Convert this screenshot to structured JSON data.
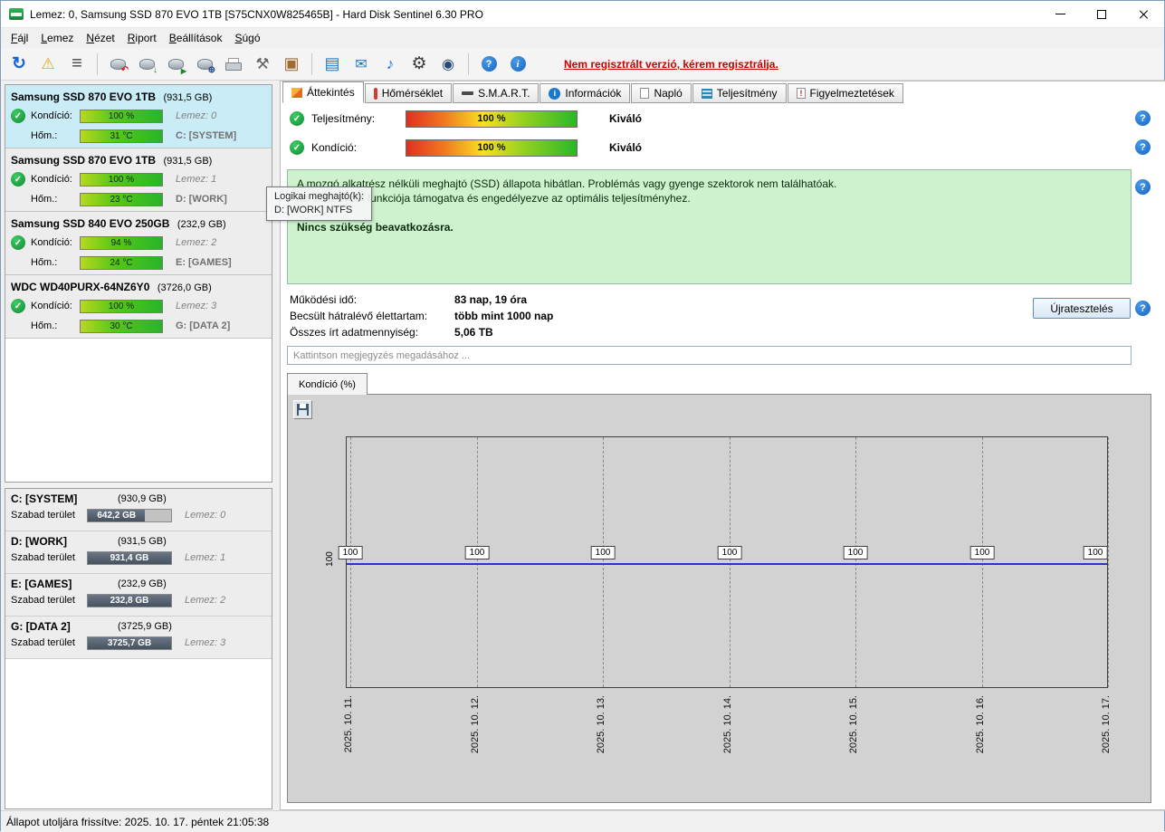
{
  "window": {
    "title": "Lemez: 0, Samsung SSD 870 EVO 1TB [S75CNX0W825465B]  -  Hard Disk Sentinel 6.30 PRO"
  },
  "menu": {
    "items": [
      "Fájl",
      "Lemez",
      "Nézet",
      "Riport",
      "Beállítások",
      "Súgó"
    ]
  },
  "toolbar": {
    "register_link": "Nem regisztrált verzió, kérem regisztrálja."
  },
  "sidebar": {
    "cond_label": "Kondíció:",
    "temp_label": "Hőm.:",
    "free_label": "Szabad terület",
    "disks": [
      {
        "name": "Samsung SSD 870 EVO 1TB",
        "size": "(931,5 GB)",
        "cond": "100 %",
        "lemez": "Lemez: 0",
        "temp": "31 °C",
        "volume": "C: [SYSTEM]"
      },
      {
        "name": "Samsung SSD 870 EVO 1TB",
        "size": "(931,5 GB)",
        "cond": "100 %",
        "lemez": "Lemez: 1",
        "temp": "23 °C",
        "volume": "D: [WORK]"
      },
      {
        "name": "Samsung SSD 840 EVO 250GB",
        "size": "(232,9 GB)",
        "cond": "94 %",
        "lemez": "Lemez: 2",
        "temp": "24 °C",
        "volume": "E: [GAMES]"
      },
      {
        "name": "WDC WD40PURX-64NZ6Y0",
        "size": "(3726,0 GB)",
        "cond": "100 %",
        "lemez": "Lemez: 3",
        "temp": "30 °C",
        "volume": "G: [DATA 2]"
      }
    ],
    "partitions": [
      {
        "name": "C: [SYSTEM]",
        "size": "(930,9 GB)",
        "free": "642,2 GB",
        "free_pct": 69,
        "lemez": "Lemez: 0"
      },
      {
        "name": "D: [WORK]",
        "size": "(931,5 GB)",
        "free": "931,4 GB",
        "free_pct": 100,
        "lemez": "Lemez: 1"
      },
      {
        "name": "E: [GAMES]",
        "size": "(232,9 GB)",
        "free": "232,8 GB",
        "free_pct": 100,
        "lemez": "Lemez: 2"
      },
      {
        "name": "G: [DATA 2]",
        "size": "(3725,9 GB)",
        "free": "3725,7 GB",
        "free_pct": 100,
        "lemez": "Lemez: 3"
      }
    ]
  },
  "tooltip": {
    "line1": "Logikai meghajtó(k):",
    "line2": "D: [WORK] NTFS"
  },
  "tabs": {
    "items": [
      "Áttekintés",
      "Hőmérséklet",
      "S.M.A.R.T.",
      "Információk",
      "Napló",
      "Teljesítmény",
      "Figyelmeztetések"
    ]
  },
  "overview": {
    "perf_label": "Teljesítmény:",
    "perf_value": "100 %",
    "perf_rating": "Kiváló",
    "cond_label": "Kondíció:",
    "cond_value": "100 %",
    "cond_rating": "Kiváló",
    "status_line1": "A mozgó alkatrész nélküli meghajtó (SSD) állapota hibátlan. Problémás vagy gyenge szektorok nem találhatóak.",
    "status_line2": "Az SSD TRIM funkciója támogatva és engedélyezve az optimális teljesítményhez.",
    "status_bold": "Nincs szükség beavatkozásra.",
    "facts": [
      {
        "label": "Működési idő:",
        "value": "83 nap, 19 óra"
      },
      {
        "label": "Becsült hátralévő élettartam:",
        "value": "több mint 1000 nap"
      },
      {
        "label": "Összes írt adatmennyiség:",
        "value": "5,06 TB"
      }
    ],
    "retest_button": "Újratesztelés",
    "comment_placeholder": "Kattintson megjegyzés megadásához ..."
  },
  "chart_tab_label": "Kondíció  (%)",
  "chart_data": {
    "type": "line",
    "title": "Kondíció (%)",
    "x": [
      "2025. 10. 11.",
      "2025. 10. 12.",
      "2025. 10. 13.",
      "2025. 10. 14.",
      "2025. 10. 15.",
      "2025. 10. 16.",
      "2025. 10. 17."
    ],
    "values": [
      100,
      100,
      100,
      100,
      100,
      100,
      100
    ],
    "point_labels": [
      "100",
      "100",
      "100",
      "100",
      "100",
      "100",
      "100"
    ],
    "ylabel_tick": "100",
    "line_color": "#2935c8",
    "grid": "vertical-dashed",
    "legend": "none"
  },
  "statusbar": {
    "text": "Állapot utoljára frissítve: 2025. 10. 17. péntek 21:05:38"
  }
}
